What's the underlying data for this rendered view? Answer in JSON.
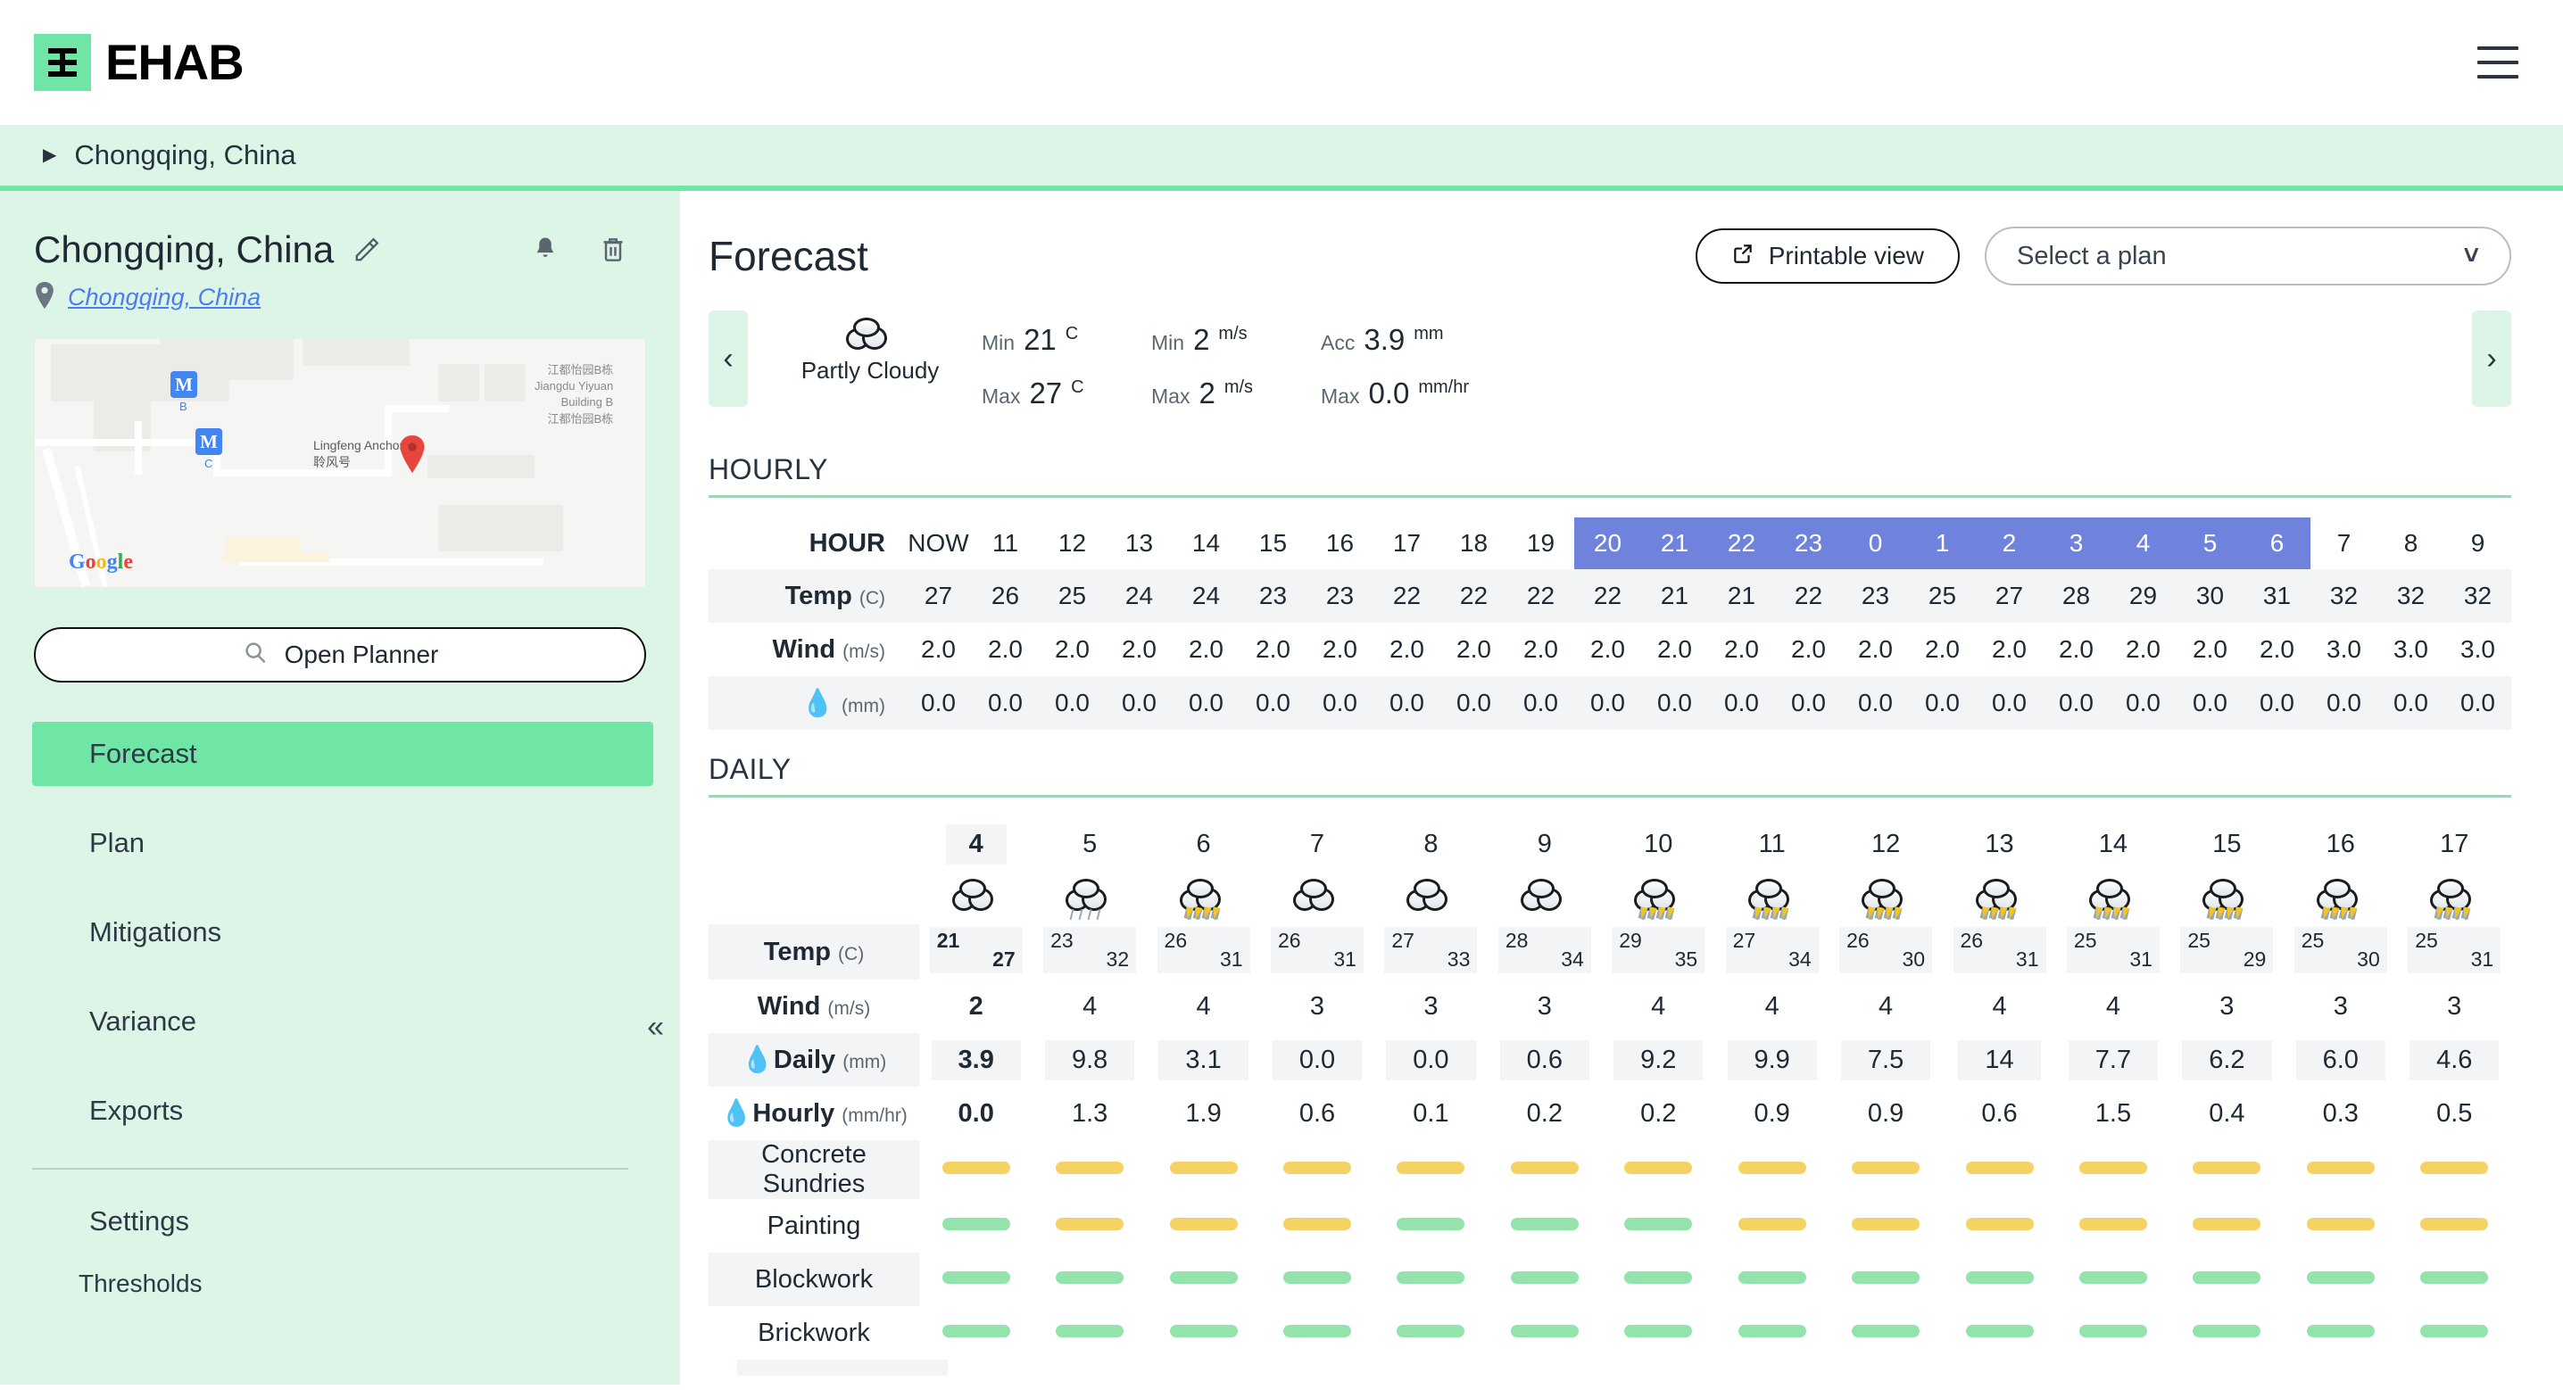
{
  "brand": {
    "name": "EHAB",
    "logo_glyph": "ehab-mark"
  },
  "breadcrumb": {
    "label": "Chongqing, China"
  },
  "sidebar": {
    "site_title": "Chongqing, China",
    "site_link": "Chongqing, China",
    "open_planner": "Open Planner",
    "nav": [
      {
        "label": "Forecast",
        "active": true
      },
      {
        "label": "Plan",
        "active": false
      },
      {
        "label": "Mitigations",
        "active": false
      },
      {
        "label": "Variance",
        "active": false
      },
      {
        "label": "Exports",
        "active": false
      }
    ],
    "settings_label": "Settings",
    "settings_children": [
      {
        "label": "Thresholds"
      }
    ],
    "map": {
      "attribution": "Google",
      "station_b": "B",
      "station_c": "C",
      "place_label": "Lingfeng Anchory\n聆风号",
      "place_label2": "江都怡园B栋\nJiangdu Yiyuan\nBuilding B\n江都怡园B栋"
    }
  },
  "main": {
    "page_title": "Forecast",
    "printable_view": "Printable view",
    "plan_select_value": "Select a plan",
    "summary": {
      "condition": "Partly Cloudy",
      "stats": [
        {
          "key": "Min",
          "value": "21",
          "unit": "C"
        },
        {
          "key": "Max",
          "value": "27",
          "unit": "C"
        },
        {
          "key": "Min",
          "value": "2",
          "unit": "m/s"
        },
        {
          "key": "Max",
          "value": "2",
          "unit": "m/s"
        },
        {
          "key": "Acc",
          "value": "3.9",
          "unit": "mm"
        },
        {
          "key": "Max",
          "value": "0.0",
          "unit": "mm/hr"
        }
      ]
    },
    "hourly_heading": "HOURLY",
    "daily_heading": "DAILY"
  },
  "chart_data": {
    "type": "table",
    "title": "Forecast — Chongqing, China",
    "hourly": {
      "row_labels": [
        {
          "name": "HOUR",
          "unit": ""
        },
        {
          "name": "Temp",
          "unit": "(C)"
        },
        {
          "name": "Wind",
          "unit": "(m/s)"
        },
        {
          "name": "droplet-icon",
          "unit": "(mm)"
        }
      ],
      "hours": [
        "NOW",
        "11",
        "12",
        "13",
        "14",
        "15",
        "16",
        "17",
        "18",
        "19",
        "20",
        "21",
        "22",
        "23",
        "0",
        "1",
        "2",
        "3",
        "4",
        "5",
        "6",
        "7",
        "8",
        "9"
      ],
      "night_hours": [
        "20",
        "21",
        "22",
        "23",
        "0",
        "1",
        "2",
        "3",
        "4",
        "5",
        "6"
      ],
      "temp_c": [
        27,
        26,
        25,
        24,
        24,
        23,
        23,
        22,
        22,
        22,
        22,
        21,
        21,
        22,
        23,
        25,
        27,
        28,
        29,
        30,
        31,
        32,
        32,
        32
      ],
      "wind_ms": [
        "2.0",
        "2.0",
        "2.0",
        "2.0",
        "2.0",
        "2.0",
        "2.0",
        "2.0",
        "2.0",
        "2.0",
        "2.0",
        "2.0",
        "2.0",
        "2.0",
        "2.0",
        "2.0",
        "2.0",
        "2.0",
        "2.0",
        "2.0",
        "2.0",
        "3.0",
        "3.0",
        "3.0"
      ],
      "rain_mm": [
        "0.0",
        "0.0",
        "0.0",
        "0.0",
        "0.0",
        "0.0",
        "0.0",
        "0.0",
        "0.0",
        "0.0",
        "0.0",
        "0.0",
        "0.0",
        "0.0",
        "0.0",
        "0.0",
        "0.0",
        "0.0",
        "0.0",
        "0.0",
        "0.0",
        "0.0",
        "0.0",
        "0.0"
      ]
    },
    "daily": {
      "row_labels": [
        {
          "name": "Temp",
          "unit": "(C)"
        },
        {
          "name": "Wind",
          "unit": "(m/s)"
        },
        {
          "name": "Daily",
          "unit": "(mm)",
          "icon": "droplet-icon"
        },
        {
          "name": "Hourly",
          "unit": "(mm/hr)",
          "icon": "droplet-icon"
        }
      ],
      "days": [
        "4",
        "5",
        "6",
        "7",
        "8",
        "9",
        "10",
        "11",
        "12",
        "13",
        "14",
        "15",
        "16",
        "17"
      ],
      "today_index": 0,
      "icons": [
        "cloudy",
        "rain",
        "thunder",
        "cloudy",
        "cloudy",
        "cloudy",
        "thunder",
        "thunder",
        "thunder",
        "thunder",
        "thunder",
        "thunder",
        "thunder",
        "thunder"
      ],
      "temp_min": [
        21,
        23,
        26,
        26,
        27,
        28,
        29,
        27,
        26,
        26,
        25,
        25,
        25,
        25
      ],
      "temp_max": [
        27,
        32,
        31,
        31,
        33,
        34,
        35,
        34,
        30,
        31,
        31,
        29,
        30,
        31
      ],
      "wind_ms": [
        2,
        4,
        4,
        3,
        3,
        3,
        4,
        4,
        4,
        4,
        4,
        3,
        3,
        3
      ],
      "rain_daily_mm": [
        "3.9",
        "9.8",
        "3.1",
        "0.0",
        "0.0",
        "0.6",
        "9.2",
        "9.9",
        "7.5",
        "14",
        "7.7",
        "6.2",
        "6.0",
        "4.6"
      ],
      "rain_hourly_mmhr": [
        "0.0",
        "1.3",
        "1.9",
        "0.6",
        "0.1",
        "0.2",
        "0.2",
        "0.9",
        "0.9",
        "0.6",
        "1.5",
        "0.4",
        "0.3",
        "0.5"
      ],
      "activities": [
        {
          "name": "Concrete Sundries",
          "status": [
            "amber",
            "amber",
            "amber",
            "amber",
            "amber",
            "amber",
            "amber",
            "amber",
            "amber",
            "amber",
            "amber",
            "amber",
            "amber",
            "amber"
          ]
        },
        {
          "name": "Painting",
          "status": [
            "green",
            "amber",
            "amber",
            "amber",
            "green",
            "green",
            "green",
            "amber",
            "amber",
            "amber",
            "amber",
            "amber",
            "amber",
            "amber"
          ]
        },
        {
          "name": "Blockwork",
          "status": [
            "green",
            "green",
            "green",
            "green",
            "green",
            "green",
            "green",
            "green",
            "green",
            "green",
            "green",
            "green",
            "green",
            "green"
          ]
        },
        {
          "name": "Brickwork",
          "status": [
            "green",
            "green",
            "green",
            "green",
            "green",
            "green",
            "green",
            "green",
            "green",
            "green",
            "green",
            "green",
            "green",
            "green"
          ]
        }
      ],
      "status_colors": {
        "green": "#94e3ac",
        "amber": "#f5d264"
      }
    }
  }
}
